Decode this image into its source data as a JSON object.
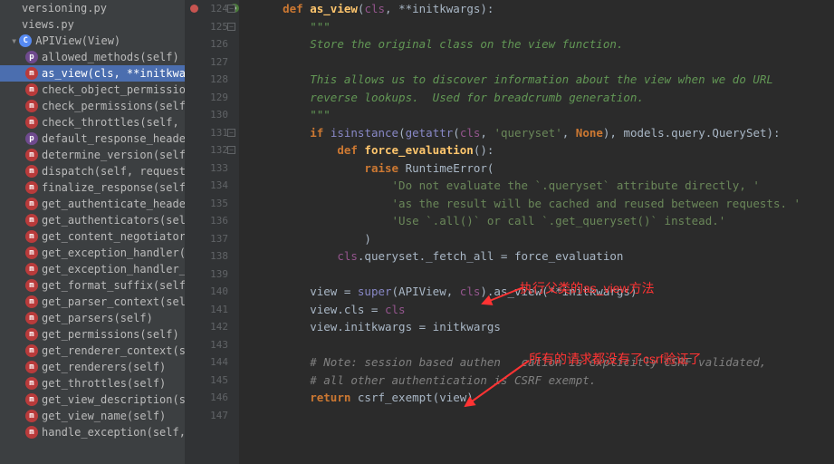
{
  "sidebar": {
    "files": [
      {
        "label": "versioning.py"
      },
      {
        "label": "views.py"
      }
    ],
    "className": "APIView(View)",
    "members": [
      {
        "icon": "prop",
        "label": "allowed_methods(self)"
      },
      {
        "icon": "method",
        "label": "as_view(cls, **initkwargs)",
        "selected": true
      },
      {
        "icon": "method",
        "label": "check_object_permissions"
      },
      {
        "icon": "method",
        "label": "check_permissions(self, re"
      },
      {
        "icon": "method",
        "label": "check_throttles(self, requ"
      },
      {
        "icon": "prop",
        "label": "default_response_headers"
      },
      {
        "icon": "method",
        "label": "determine_version(self, re"
      },
      {
        "icon": "method",
        "label": "dispatch(self, request, *ar"
      },
      {
        "icon": "method",
        "label": "finalize_response(self, re"
      },
      {
        "icon": "method",
        "label": "get_authenticate_header(s"
      },
      {
        "icon": "method",
        "label": "get_authenticators(self)"
      },
      {
        "icon": "method",
        "label": "get_content_negotiator(se"
      },
      {
        "icon": "method",
        "label": "get_exception_handler(sel"
      },
      {
        "icon": "method",
        "label": "get_exception_handler_co"
      },
      {
        "icon": "method",
        "label": "get_format_suffix(self, **k"
      },
      {
        "icon": "method",
        "label": "get_parser_context(self, h"
      },
      {
        "icon": "method",
        "label": "get_parsers(self)"
      },
      {
        "icon": "method",
        "label": "get_permissions(self)"
      },
      {
        "icon": "method",
        "label": "get_renderer_context(self"
      },
      {
        "icon": "method",
        "label": "get_renderers(self)"
      },
      {
        "icon": "method",
        "label": "get_throttles(self)"
      },
      {
        "icon": "method",
        "label": "get_view_description(self,"
      },
      {
        "icon": "method",
        "label": "get_view_name(self)"
      },
      {
        "icon": "method",
        "label": "handle_exception(self, exc"
      }
    ]
  },
  "editor": {
    "startLine": 124,
    "lines": [
      {
        "n": 124,
        "html": "<span class='kw'>def</span> <span class='fn'>as_view</span>(<span class='self'>cls</span>, **<span class='param'>initkwargs</span>):",
        "indent": 1,
        "fold": true,
        "override": true
      },
      {
        "n": 125,
        "html": "<span class='docstr'>\"\"\"</span>",
        "indent": 2,
        "fold": true
      },
      {
        "n": 126,
        "html": "<span class='docstr'>Store the original class on the view function.</span>",
        "indent": 2
      },
      {
        "n": 127,
        "html": "",
        "indent": 2
      },
      {
        "n": 128,
        "html": "<span class='docstr'>This allows us to discover information about the view when we do URL</span>",
        "indent": 2
      },
      {
        "n": 129,
        "html": "<span class='docstr'>reverse lookups.  Used for breadcrumb generation.</span>",
        "indent": 2
      },
      {
        "n": 130,
        "html": "<span class='docstr'>\"\"\"</span>",
        "indent": 2
      },
      {
        "n": 131,
        "html": "<span class='kw'>if</span> <span class='builtin'>isinstance</span>(<span class='builtin'>getattr</span>(<span class='self'>cls</span>, <span class='str'>'queryset'</span>, <span class='kw'>None</span>), models.query.QuerySet):",
        "indent": 2,
        "fold": true
      },
      {
        "n": 132,
        "html": "<span class='kw'>def</span> <span class='fn'>force_evaluation</span>():",
        "indent": 3,
        "fold": true
      },
      {
        "n": 133,
        "html": "<span class='kw'>raise</span> RuntimeError(",
        "indent": 4
      },
      {
        "n": 134,
        "html": "<span class='str'>'Do not evaluate the `.queryset` attribute directly, '</span>",
        "indent": 5
      },
      {
        "n": 135,
        "html": "<span class='str'>'as the result will be cached and reused between requests. '</span>",
        "indent": 5
      },
      {
        "n": 136,
        "html": "<span class='str'>'Use `.all()` or call `.get_queryset()` instead.'</span>",
        "indent": 5
      },
      {
        "n": 137,
        "html": ")",
        "indent": 4
      },
      {
        "n": 138,
        "html": "<span class='self'>cls</span>.queryset._fetch_all = force_evaluation",
        "indent": 3
      },
      {
        "n": 139,
        "html": "",
        "indent": 2
      },
      {
        "n": 140,
        "html": "view = <span class='builtin'>super</span>(APIView, <span class='self'>cls</span>).as_view(**initkwargs)",
        "indent": 2
      },
      {
        "n": 141,
        "html": "view.cls = <span class='self'>cls</span>",
        "indent": 2
      },
      {
        "n": 142,
        "html": "view.initkwargs = initkwargs",
        "indent": 2
      },
      {
        "n": 143,
        "html": "",
        "indent": 2
      },
      {
        "n": 144,
        "html": "<span class='comment'># Note: session based authen   cation is explicitly CSRF validated,</span>",
        "indent": 2
      },
      {
        "n": 145,
        "html": "<span class='comment'># all other authentication is CSRF exempt.</span>",
        "indent": 2
      },
      {
        "n": 146,
        "html": "<span class='kw'>return</span> csrf_exempt(view)",
        "indent": 2
      },
      {
        "n": 147,
        "html": "",
        "indent": 0
      }
    ]
  },
  "annotations": {
    "a1": "执行父类的as_view方法",
    "a2": "所有的请求都没有了csrf验证了"
  }
}
